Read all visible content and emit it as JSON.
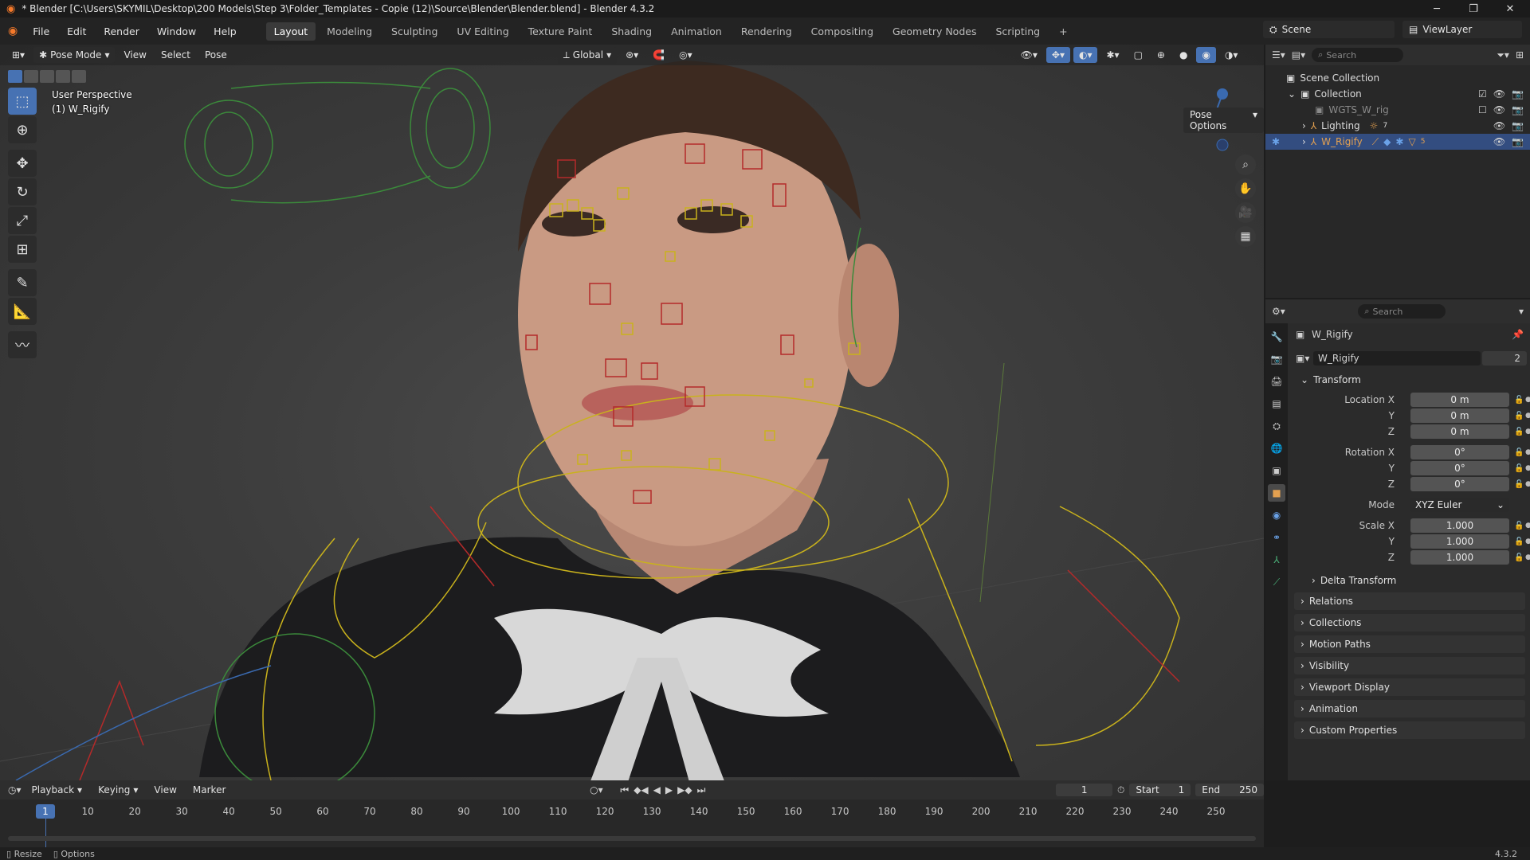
{
  "window": {
    "title": "* Blender [C:\\Users\\SKYMIL\\Desktop\\200 Models\\Step 3\\Folder_Templates - Copie (12)\\Source\\Blender\\Blender.blend] - Blender 4.3.2"
  },
  "menu": [
    "File",
    "Edit",
    "Render",
    "Window",
    "Help"
  ],
  "workspaces": [
    "Layout",
    "Modeling",
    "Sculpting",
    "UV Editing",
    "Texture Paint",
    "Shading",
    "Animation",
    "Rendering",
    "Compositing",
    "Geometry Nodes",
    "Scripting"
  ],
  "active_workspace": "Layout",
  "scene": {
    "label": "Scene"
  },
  "view_layer": {
    "label": "ViewLayer"
  },
  "viewport": {
    "mode": "Pose Mode",
    "menus": [
      "View",
      "Select",
      "Pose"
    ],
    "orientation": "Global",
    "overlay_text": [
      "User Perspective",
      "(1) W_Rigify"
    ],
    "pose_options": "Pose Options",
    "gizmo_axes": [
      "Z",
      "Y",
      "X"
    ]
  },
  "outliner": {
    "search_placeholder": "Search",
    "rows": [
      {
        "label": "Scene Collection"
      },
      {
        "label": "Collection"
      },
      {
        "label": "WGTS_W_rig"
      },
      {
        "label": "Lighting",
        "badge": "7"
      },
      {
        "label": "W_Rigify",
        "badge": "5"
      }
    ]
  },
  "properties": {
    "search_placeholder": "Search",
    "object_name": "W_Rigify",
    "data_name": "W_Rigify",
    "users": "2",
    "transform_label": "Transform",
    "location_label": "Location X",
    "rotation_label": "Rotation X",
    "scale_label": "Scale X",
    "axis_y": "Y",
    "axis_z": "Z",
    "location": [
      "0 m",
      "0 m",
      "0 m"
    ],
    "rotation": [
      "0°",
      "0°",
      "0°"
    ],
    "mode_label": "Mode",
    "mode": "XYZ Euler",
    "scale": [
      "1.000",
      "1.000",
      "1.000"
    ],
    "delta": "Delta Transform",
    "panels": [
      "Relations",
      "Collections",
      "Motion Paths",
      "Visibility",
      "Viewport Display",
      "Animation",
      "Custom Properties"
    ]
  },
  "timeline": {
    "menus": [
      "Playback",
      "Keying",
      "View",
      "Marker"
    ],
    "current_frame": "1",
    "start_label": "Start",
    "start": "1",
    "end_label": "End",
    "end": "250",
    "ticks": [
      "1",
      "10",
      "20",
      "30",
      "40",
      "50",
      "60",
      "70",
      "80",
      "90",
      "100",
      "110",
      "120",
      "130",
      "140",
      "150",
      "160",
      "170",
      "180",
      "190",
      "200",
      "210",
      "220",
      "230",
      "240",
      "250"
    ]
  },
  "status": {
    "left": [
      "Resize",
      "Options"
    ],
    "version": "4.3.2"
  }
}
